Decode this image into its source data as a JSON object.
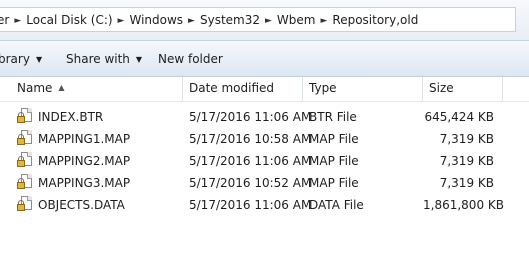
{
  "address": {
    "crumbs": [
      "er",
      "Local Disk (C:)",
      "Windows",
      "System32",
      "Wbem",
      "Repository,old"
    ]
  },
  "toolbar": {
    "library_label": "brary",
    "share_label": "Share with",
    "new_folder_label": "New folder"
  },
  "columns": {
    "name": "Name",
    "date": "Date modified",
    "type": "Type",
    "size": "Size"
  },
  "files": [
    {
      "name": "INDEX.BTR",
      "date": "5/17/2016 11:06 AM",
      "type": "BTR File",
      "size": "645,424 KB",
      "icon": "locked-file-icon"
    },
    {
      "name": "MAPPING1.MAP",
      "date": "5/17/2016 10:58 AM",
      "type": "MAP File",
      "size": "7,319 KB",
      "icon": "locked-file-icon"
    },
    {
      "name": "MAPPING2.MAP",
      "date": "5/17/2016 11:06 AM",
      "type": "MAP File",
      "size": "7,319 KB",
      "icon": "locked-file-icon"
    },
    {
      "name": "MAPPING3.MAP",
      "date": "5/17/2016 10:52 AM",
      "type": "MAP File",
      "size": "7,319 KB",
      "icon": "locked-file-icon"
    },
    {
      "name": "OBJECTS.DATA",
      "date": "5/17/2016 11:06 AM",
      "type": "DATA File",
      "size": "1,861,800 KB",
      "icon": "locked-file-icon"
    }
  ]
}
